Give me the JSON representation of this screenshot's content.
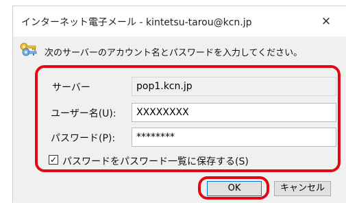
{
  "window": {
    "title": "インターネット電子メール - kintetsu-tarou@kcn.jp",
    "close_label": "×"
  },
  "message": {
    "icon": "key-icon",
    "text": "次のサーバーのアカウント名とパスワードを入力してください。"
  },
  "fields": {
    "server_label": "サーバー",
    "server_value": "pop1.kcn.jp",
    "username_label": "ユーザー名(U):",
    "username_value": "XXXXXXXX",
    "password_label": "パスワード(P):",
    "password_value": "********"
  },
  "save_password": {
    "checked": true,
    "check_mark": "✓",
    "label": "パスワードをパスワード一覧に保存する(S)"
  },
  "buttons": {
    "ok_label": "OK",
    "cancel_label": "キャンセル"
  },
  "colors": {
    "highlight": "#e30613",
    "dialog_background": "#f0f0f0",
    "ok_border": "#0078d7"
  }
}
